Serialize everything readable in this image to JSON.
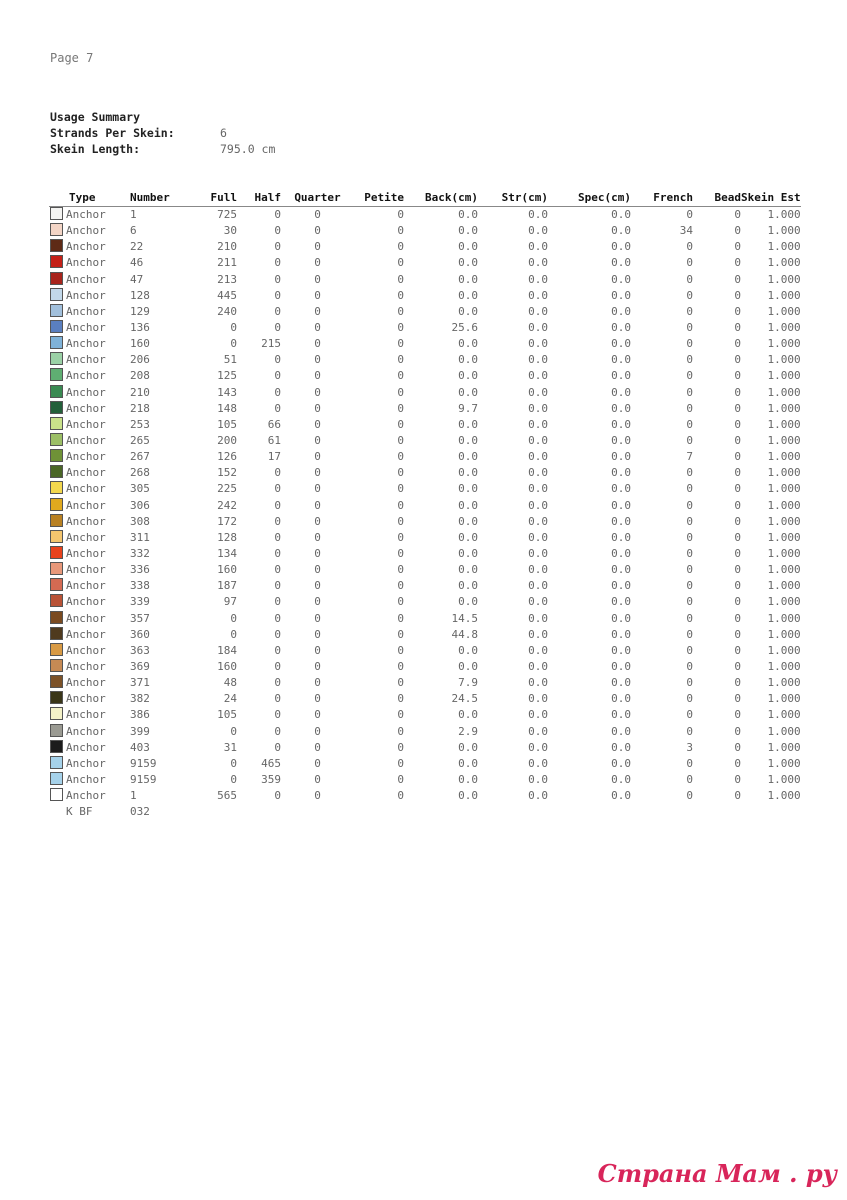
{
  "page_label": "Page 7",
  "summary": {
    "title": "Usage Summary",
    "strands_label": "Strands Per Skein:",
    "strands_value": "6",
    "length_label": "Skein Length:",
    "length_value": "795.0 cm"
  },
  "table": {
    "headers": {
      "type": "Type",
      "number": "Number",
      "full": "Full",
      "half": "Half",
      "quarter": "Quarter",
      "petite": "Petite",
      "back": "Back(cm)",
      "str": "Str(cm)",
      "spec": "Spec(cm)",
      "french": "French",
      "bead": "Bead",
      "skein": "Skein Est"
    },
    "rows": [
      {
        "color": "#f4f4f2",
        "type": "Anchor",
        "number": "1",
        "full": "725",
        "half": "0",
        "quarter": "0",
        "petite": "0",
        "back": "0.0",
        "str": "0.0",
        "spec": "0.0",
        "french": "0",
        "bead": "0",
        "skein": "1.000"
      },
      {
        "color": "#f3d5c6",
        "type": "Anchor",
        "number": "6",
        "full": "30",
        "half": "0",
        "quarter": "0",
        "petite": "0",
        "back": "0.0",
        "str": "0.0",
        "spec": "0.0",
        "french": "34",
        "bead": "0",
        "skein": "1.000"
      },
      {
        "color": "#5e2a16",
        "type": "Anchor",
        "number": "22",
        "full": "210",
        "half": "0",
        "quarter": "0",
        "petite": "0",
        "back": "0.0",
        "str": "0.0",
        "spec": "0.0",
        "french": "0",
        "bead": "0",
        "skein": "1.000"
      },
      {
        "color": "#c42017",
        "type": "Anchor",
        "number": "46",
        "full": "211",
        "half": "0",
        "quarter": "0",
        "petite": "0",
        "back": "0.0",
        "str": "0.0",
        "spec": "0.0",
        "french": "0",
        "bead": "0",
        "skein": "1.000"
      },
      {
        "color": "#a8241c",
        "type": "Anchor",
        "number": "47",
        "full": "213",
        "half": "0",
        "quarter": "0",
        "petite": "0",
        "back": "0.0",
        "str": "0.0",
        "spec": "0.0",
        "french": "0",
        "bead": "0",
        "skein": "1.000"
      },
      {
        "color": "#c2d8ea",
        "type": "Anchor",
        "number": "128",
        "full": "445",
        "half": "0",
        "quarter": "0",
        "petite": "0",
        "back": "0.0",
        "str": "0.0",
        "spec": "0.0",
        "french": "0",
        "bead": "0",
        "skein": "1.000"
      },
      {
        "color": "#a2c0dc",
        "type": "Anchor",
        "number": "129",
        "full": "240",
        "half": "0",
        "quarter": "0",
        "petite": "0",
        "back": "0.0",
        "str": "0.0",
        "spec": "0.0",
        "french": "0",
        "bead": "0",
        "skein": "1.000"
      },
      {
        "color": "#5a7fbf",
        "type": "Anchor",
        "number": "136",
        "full": "0",
        "half": "0",
        "quarter": "0",
        "petite": "0",
        "back": "25.6",
        "str": "0.0",
        "spec": "0.0",
        "french": "0",
        "bead": "0",
        "skein": "1.000"
      },
      {
        "color": "#7fb2d8",
        "type": "Anchor",
        "number": "160",
        "full": "0",
        "half": "215",
        "quarter": "0",
        "petite": "0",
        "back": "0.0",
        "str": "0.0",
        "spec": "0.0",
        "french": "0",
        "bead": "0",
        "skein": "1.000"
      },
      {
        "color": "#9bd1a6",
        "type": "Anchor",
        "number": "206",
        "full": "51",
        "half": "0",
        "quarter": "0",
        "petite": "0",
        "back": "0.0",
        "str": "0.0",
        "spec": "0.0",
        "french": "0",
        "bead": "0",
        "skein": "1.000"
      },
      {
        "color": "#5fae72",
        "type": "Anchor",
        "number": "208",
        "full": "125",
        "half": "0",
        "quarter": "0",
        "petite": "0",
        "back": "0.0",
        "str": "0.0",
        "spec": "0.0",
        "french": "0",
        "bead": "0",
        "skein": "1.000"
      },
      {
        "color": "#3a8a52",
        "type": "Anchor",
        "number": "210",
        "full": "143",
        "half": "0",
        "quarter": "0",
        "petite": "0",
        "back": "0.0",
        "str": "0.0",
        "spec": "0.0",
        "french": "0",
        "bead": "0",
        "skein": "1.000"
      },
      {
        "color": "#23603a",
        "type": "Anchor",
        "number": "218",
        "full": "148",
        "half": "0",
        "quarter": "0",
        "petite": "0",
        "back": "9.7",
        "str": "0.0",
        "spec": "0.0",
        "french": "0",
        "bead": "0",
        "skein": "1.000"
      },
      {
        "color": "#c9e28a",
        "type": "Anchor",
        "number": "253",
        "full": "105",
        "half": "66",
        "quarter": "0",
        "petite": "0",
        "back": "0.0",
        "str": "0.0",
        "spec": "0.0",
        "french": "0",
        "bead": "0",
        "skein": "1.000"
      },
      {
        "color": "#9cbf66",
        "type": "Anchor",
        "number": "265",
        "full": "200",
        "half": "61",
        "quarter": "0",
        "petite": "0",
        "back": "0.0",
        "str": "0.0",
        "spec": "0.0",
        "french": "0",
        "bead": "0",
        "skein": "1.000"
      },
      {
        "color": "#6f9237",
        "type": "Anchor",
        "number": "267",
        "full": "126",
        "half": "17",
        "quarter": "0",
        "petite": "0",
        "back": "0.0",
        "str": "0.0",
        "spec": "0.0",
        "french": "7",
        "bead": "0",
        "skein": "1.000"
      },
      {
        "color": "#4a6626",
        "type": "Anchor",
        "number": "268",
        "full": "152",
        "half": "0",
        "quarter": "0",
        "petite": "0",
        "back": "0.0",
        "str": "0.0",
        "spec": "0.0",
        "french": "0",
        "bead": "0",
        "skein": "1.000"
      },
      {
        "color": "#f3d84e",
        "type": "Anchor",
        "number": "305",
        "full": "225",
        "half": "0",
        "quarter": "0",
        "petite": "0",
        "back": "0.0",
        "str": "0.0",
        "spec": "0.0",
        "french": "0",
        "bead": "0",
        "skein": "1.000"
      },
      {
        "color": "#e0a91e",
        "type": "Anchor",
        "number": "306",
        "full": "242",
        "half": "0",
        "quarter": "0",
        "petite": "0",
        "back": "0.0",
        "str": "0.0",
        "spec": "0.0",
        "french": "0",
        "bead": "0",
        "skein": "1.000"
      },
      {
        "color": "#b98122",
        "type": "Anchor",
        "number": "308",
        "full": "172",
        "half": "0",
        "quarter": "0",
        "petite": "0",
        "back": "0.0",
        "str": "0.0",
        "spec": "0.0",
        "french": "0",
        "bead": "0",
        "skein": "1.000"
      },
      {
        "color": "#f4c56e",
        "type": "Anchor",
        "number": "311",
        "full": "128",
        "half": "0",
        "quarter": "0",
        "petite": "0",
        "back": "0.0",
        "str": "0.0",
        "spec": "0.0",
        "french": "0",
        "bead": "0",
        "skein": "1.000"
      },
      {
        "color": "#e8421c",
        "type": "Anchor",
        "number": "332",
        "full": "134",
        "half": "0",
        "quarter": "0",
        "petite": "0",
        "back": "0.0",
        "str": "0.0",
        "spec": "0.0",
        "french": "0",
        "bead": "0",
        "skein": "1.000"
      },
      {
        "color": "#e8987a",
        "type": "Anchor",
        "number": "336",
        "full": "160",
        "half": "0",
        "quarter": "0",
        "petite": "0",
        "back": "0.0",
        "str": "0.0",
        "spec": "0.0",
        "french": "0",
        "bead": "0",
        "skein": "1.000"
      },
      {
        "color": "#d46a52",
        "type": "Anchor",
        "number": "338",
        "full": "187",
        "half": "0",
        "quarter": "0",
        "petite": "0",
        "back": "0.0",
        "str": "0.0",
        "spec": "0.0",
        "french": "0",
        "bead": "0",
        "skein": "1.000"
      },
      {
        "color": "#b95236",
        "type": "Anchor",
        "number": "339",
        "full": "97",
        "half": "0",
        "quarter": "0",
        "petite": "0",
        "back": "0.0",
        "str": "0.0",
        "spec": "0.0",
        "french": "0",
        "bead": "0",
        "skein": "1.000"
      },
      {
        "color": "#7a4a20",
        "type": "Anchor",
        "number": "357",
        "full": "0",
        "half": "0",
        "quarter": "0",
        "petite": "0",
        "back": "14.5",
        "str": "0.0",
        "spec": "0.0",
        "french": "0",
        "bead": "0",
        "skein": "1.000"
      },
      {
        "color": "#4f3a1e",
        "type": "Anchor",
        "number": "360",
        "full": "0",
        "half": "0",
        "quarter": "0",
        "petite": "0",
        "back": "44.8",
        "str": "0.0",
        "spec": "0.0",
        "french": "0",
        "bead": "0",
        "skein": "1.000"
      },
      {
        "color": "#d89a44",
        "type": "Anchor",
        "number": "363",
        "full": "184",
        "half": "0",
        "quarter": "0",
        "petite": "0",
        "back": "0.0",
        "str": "0.0",
        "spec": "0.0",
        "french": "0",
        "bead": "0",
        "skein": "1.000"
      },
      {
        "color": "#c68a54",
        "type": "Anchor",
        "number": "369",
        "full": "160",
        "half": "0",
        "quarter": "0",
        "petite": "0",
        "back": "0.0",
        "str": "0.0",
        "spec": "0.0",
        "french": "0",
        "bead": "0",
        "skein": "1.000"
      },
      {
        "color": "#7c5228",
        "type": "Anchor",
        "number": "371",
        "full": "48",
        "half": "0",
        "quarter": "0",
        "petite": "0",
        "back": "7.9",
        "str": "0.0",
        "spec": "0.0",
        "french": "0",
        "bead": "0",
        "skein": "1.000"
      },
      {
        "color": "#3a3618",
        "type": "Anchor",
        "number": "382",
        "full": "24",
        "half": "0",
        "quarter": "0",
        "petite": "0",
        "back": "24.5",
        "str": "0.0",
        "spec": "0.0",
        "french": "0",
        "bead": "0",
        "skein": "1.000"
      },
      {
        "color": "#f4f2c8",
        "type": "Anchor",
        "number": "386",
        "full": "105",
        "half": "0",
        "quarter": "0",
        "petite": "0",
        "back": "0.0",
        "str": "0.0",
        "spec": "0.0",
        "french": "0",
        "bead": "0",
        "skein": "1.000"
      },
      {
        "color": "#9a9a92",
        "type": "Anchor",
        "number": "399",
        "full": "0",
        "half": "0",
        "quarter": "0",
        "petite": "0",
        "back": "2.9",
        "str": "0.0",
        "spec": "0.0",
        "french": "0",
        "bead": "0",
        "skein": "1.000"
      },
      {
        "color": "#1c1c1c",
        "type": "Anchor",
        "number": "403",
        "full": "31",
        "half": "0",
        "quarter": "0",
        "petite": "0",
        "back": "0.0",
        "str": "0.0",
        "spec": "0.0",
        "french": "3",
        "bead": "0",
        "skein": "1.000"
      },
      {
        "color": "#a6d2ea",
        "type": "Anchor",
        "number": "9159",
        "full": "0",
        "half": "465",
        "quarter": "0",
        "petite": "0",
        "back": "0.0",
        "str": "0.0",
        "spec": "0.0",
        "french": "0",
        "bead": "0",
        "skein": "1.000"
      },
      {
        "color": "#a6d2ea",
        "type": "Anchor",
        "number": "9159",
        "full": "0",
        "half": "359",
        "quarter": "0",
        "petite": "0",
        "back": "0.0",
        "str": "0.0",
        "spec": "0.0",
        "french": "0",
        "bead": "0",
        "skein": "1.000"
      }
    ],
    "last_row": {
      "type": "Anchor",
      "type2": "K BF",
      "number": "1",
      "number2": "032",
      "full": "565",
      "half": "0",
      "quarter": "0",
      "petite": "0",
      "back": "0.0",
      "str": "0.0",
      "spec": "0.0",
      "french": "0",
      "bead": "0",
      "skein": "1.000"
    }
  },
  "watermark": "Страна Мам . ру"
}
